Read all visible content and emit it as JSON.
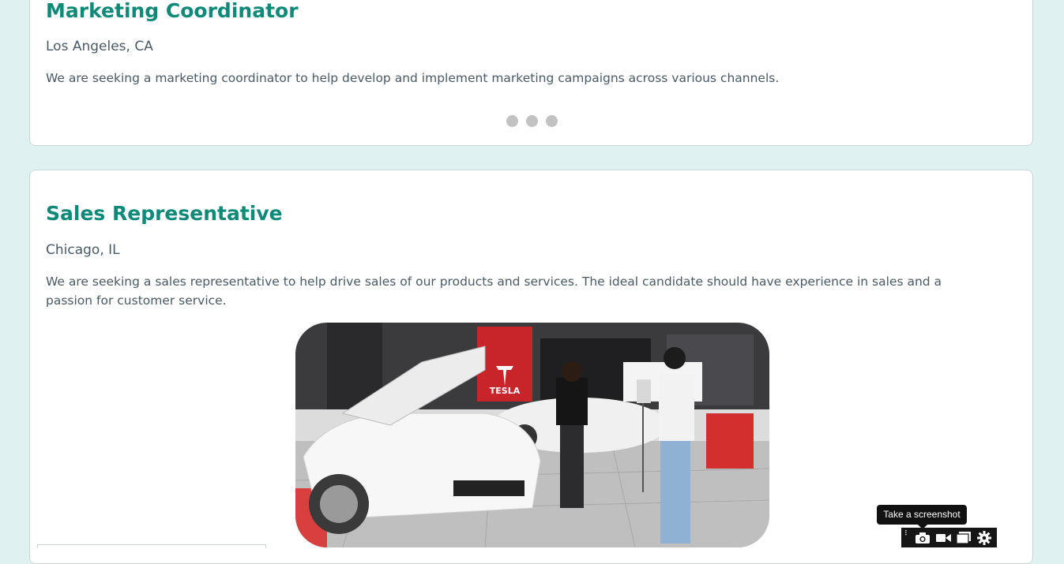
{
  "jobs": [
    {
      "title": "Marketing Coordinator",
      "location": "Los Angeles, CA",
      "description": "We are seeking a marketing coordinator to help develop and implement marketing campaigns across various channels."
    },
    {
      "title": "Sales Representative",
      "location": "Chicago, IL",
      "description": "We are seeking a sales representative to help drive sales of our products and services. The ideal candidate should have experience in sales and a passion for customer service.",
      "image_sign": "TESLA"
    }
  ],
  "carousel": {
    "dot_count": 3
  },
  "screenshot_toolbar": {
    "tooltip": "Take a screenshot",
    "buttons": [
      "camera-icon",
      "video-camera-icon",
      "window-icon",
      "gear-icon"
    ]
  },
  "colors": {
    "page_background": "#dff1f1",
    "title": "#0f8a78",
    "body_text": "#4a5a64",
    "dot": "#c2c2c2"
  }
}
